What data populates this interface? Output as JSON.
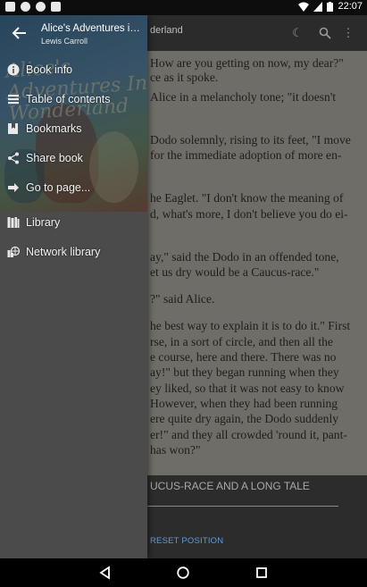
{
  "status_bar": {
    "time": "22:07",
    "icons": [
      "notification-icon",
      "skype-icon",
      "android-icon",
      "cloud-upload-icon"
    ],
    "right_icons": [
      "wifi-icon",
      "signal-icon",
      "battery-icon"
    ]
  },
  "reader": {
    "title_fragment": "derland",
    "toolbar_icons": [
      "night-mode-icon",
      "search-icon",
      "more-vert-icon"
    ],
    "lines": [
      "How are you getting on now, my dear?\"",
      "ce as it spoke.",
      "Alice in a melancholy tone; \"it doesn't",
      "",
      "Dodo solemnly, rising to its feet, \"I move",
      "for the immediate adoption of more en-",
      "",
      "he Eaglet. \"I don't know the meaning of",
      "d, what's more, I don't believe you do ei-",
      "",
      "ay,\" said the Dodo in an offended tone,",
      "et us dry would be a Caucus-race.\"",
      "",
      "?\" said Alice.",
      "",
      "he best way to explain it is to do it.\" First",
      "rse, in a sort of circle, and then all the",
      "e course, here and there. There was no",
      "ay!\" but they began running when they",
      "ey liked, so that it was not easy to know",
      "However, when they had been running",
      "ere quite dry again, the Dodo suddenly",
      "er!\" and they all crowded 'round it, pant-",
      "has won?\""
    ],
    "chapter_label": "UCUS-RACE AND A LONG TALE",
    "reset_label": "RESET POSITION"
  },
  "drawer": {
    "book_title": "Alice's Adventures in Wonderland",
    "author": "Lewis Carroll",
    "cover_art_text": "Alice's Adventures In Wonderland",
    "items": [
      {
        "label": "Book info",
        "icon": "info-icon"
      },
      {
        "label": "Table of contents",
        "icon": "list-icon"
      },
      {
        "label": "Bookmarks",
        "icon": "bookmarks-icon"
      },
      {
        "label": "Share book",
        "icon": "share-icon"
      },
      {
        "label": "Go to page...",
        "icon": "go-to-page-icon"
      },
      {
        "label": "Library",
        "icon": "library-icon"
      },
      {
        "label": "Network library",
        "icon": "network-library-icon"
      }
    ]
  },
  "nav_bar": {
    "buttons": [
      "back-nav-icon",
      "home-nav-icon",
      "recents-nav-icon"
    ]
  },
  "colors": {
    "drawer_bg": "#4b4b4b",
    "reader_bg": "#6f6d67",
    "accent": "#5e9bd6"
  }
}
